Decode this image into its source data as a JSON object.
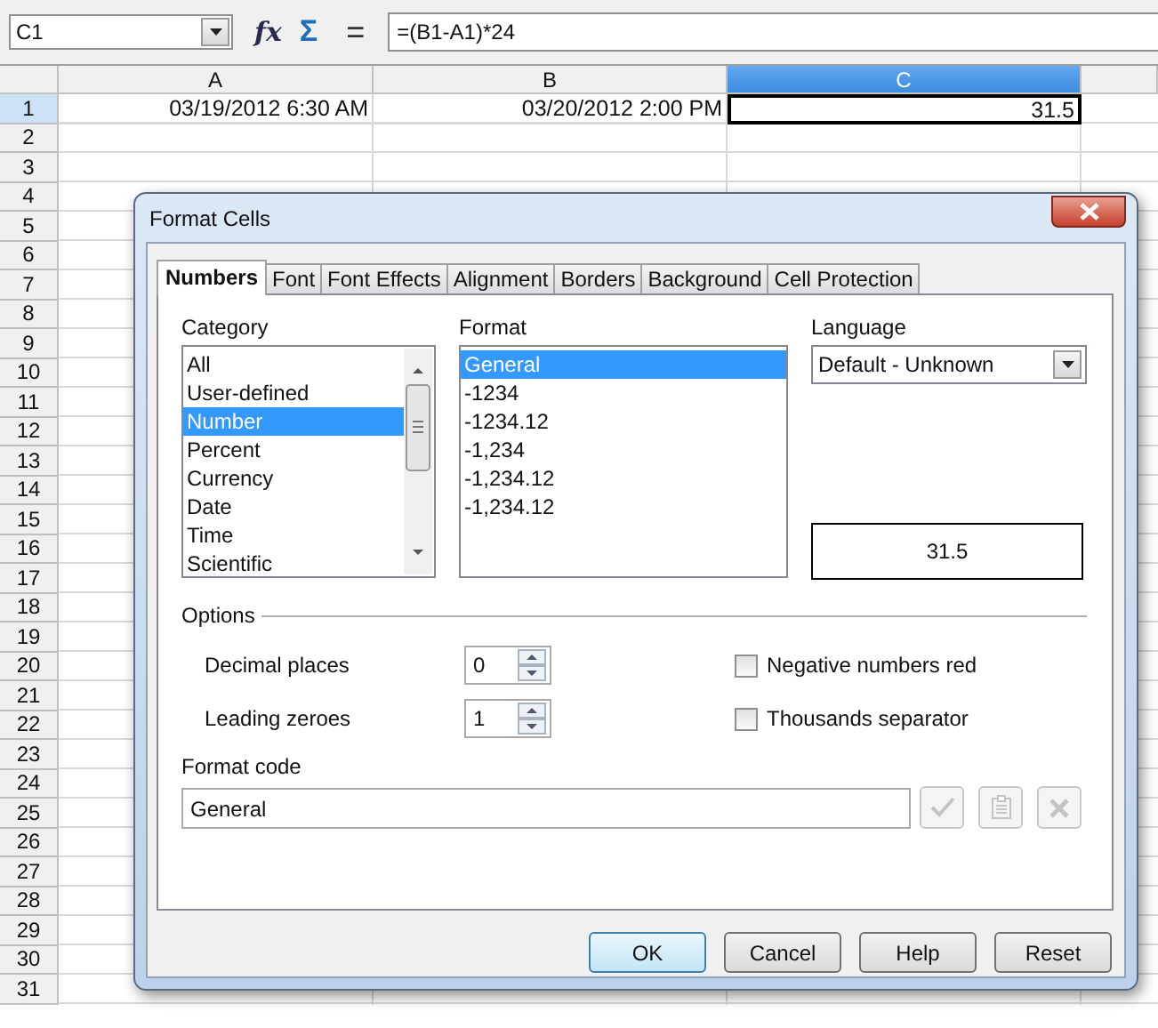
{
  "name_box": {
    "value": "C1"
  },
  "formula_tools": [
    {
      "kind": "function",
      "label": "fx"
    },
    {
      "kind": "sum",
      "label": "Σ"
    },
    {
      "kind": "equals",
      "label": "="
    }
  ],
  "formula": {
    "value": "=(B1-A1)*24"
  },
  "sheet": {
    "columns": [
      {
        "label": "A",
        "selected": false
      },
      {
        "label": "B",
        "selected": false
      },
      {
        "label": "C",
        "selected": true
      }
    ],
    "rows": [
      {
        "label": "1",
        "selected": true,
        "cells": [
          "03/19/2012 6:30 AM",
          "03/20/2012 2:00 PM",
          "31.5"
        ]
      },
      {
        "label": "2",
        "selected": false
      },
      {
        "label": "3",
        "selected": false
      },
      {
        "label": "4",
        "selected": false
      },
      {
        "label": "5",
        "selected": false
      },
      {
        "label": "6",
        "selected": false
      },
      {
        "label": "7",
        "selected": false
      },
      {
        "label": "8",
        "selected": false
      },
      {
        "label": "9",
        "selected": false
      },
      {
        "label": "10",
        "selected": false
      },
      {
        "label": "11",
        "selected": false
      },
      {
        "label": "12",
        "selected": false
      },
      {
        "label": "13",
        "selected": false
      },
      {
        "label": "14",
        "selected": false
      },
      {
        "label": "15",
        "selected": false
      },
      {
        "label": "16",
        "selected": false
      },
      {
        "label": "17",
        "selected": false
      },
      {
        "label": "18",
        "selected": false
      },
      {
        "label": "19",
        "selected": false
      },
      {
        "label": "20",
        "selected": false
      },
      {
        "label": "21",
        "selected": false
      },
      {
        "label": "22",
        "selected": false
      },
      {
        "label": "23",
        "selected": false
      },
      {
        "label": "24",
        "selected": false
      },
      {
        "label": "25",
        "selected": false
      },
      {
        "label": "26",
        "selected": false
      },
      {
        "label": "27",
        "selected": false
      },
      {
        "label": "28",
        "selected": false
      },
      {
        "label": "29",
        "selected": false
      },
      {
        "label": "30",
        "selected": false
      },
      {
        "label": "31",
        "selected": false
      }
    ]
  },
  "dialog": {
    "title": "Format Cells",
    "tabs": [
      {
        "label": "Numbers",
        "selected": true
      },
      {
        "label": "Font",
        "selected": false
      },
      {
        "label": "Font Effects",
        "selected": false
      },
      {
        "label": "Alignment",
        "selected": false
      },
      {
        "label": "Borders",
        "selected": false
      },
      {
        "label": "Background",
        "selected": false
      },
      {
        "label": "Cell Protection",
        "selected": false
      }
    ],
    "category": {
      "label": "Category",
      "items": [
        {
          "label": "All",
          "selected": false
        },
        {
          "label": "User-defined",
          "selected": false
        },
        {
          "label": "Number",
          "selected": true
        },
        {
          "label": "Percent",
          "selected": false
        },
        {
          "label": "Currency",
          "selected": false
        },
        {
          "label": "Date",
          "selected": false
        },
        {
          "label": "Time",
          "selected": false
        },
        {
          "label": "Scientific",
          "selected": false
        }
      ]
    },
    "format": {
      "label": "Format",
      "items": [
        {
          "label": "General",
          "selected": true
        },
        {
          "label": "-1234",
          "selected": false
        },
        {
          "label": "-1234.12",
          "selected": false
        },
        {
          "label": "-1,234",
          "selected": false
        },
        {
          "label": "-1,234.12",
          "selected": false
        },
        {
          "label": "-1,234.12",
          "selected": false
        }
      ]
    },
    "language": {
      "label": "Language",
      "value": "Default - Unknown"
    },
    "preview": "31.5",
    "options": {
      "label": "Options",
      "spinners": [
        {
          "label": "Decimal places",
          "value": "0"
        },
        {
          "label": "Leading zeroes",
          "value": "1"
        }
      ],
      "checkboxes": [
        {
          "label": "Negative numbers red",
          "checked": false
        },
        {
          "label": "Thousands separator",
          "checked": false
        }
      ]
    },
    "format_code": {
      "label": "Format code",
      "value": "General"
    },
    "buttons": [
      {
        "label": "OK",
        "default": true
      },
      {
        "label": "Cancel",
        "default": false
      },
      {
        "label": "Help",
        "default": false
      },
      {
        "label": "Reset",
        "default": false
      }
    ]
  }
}
